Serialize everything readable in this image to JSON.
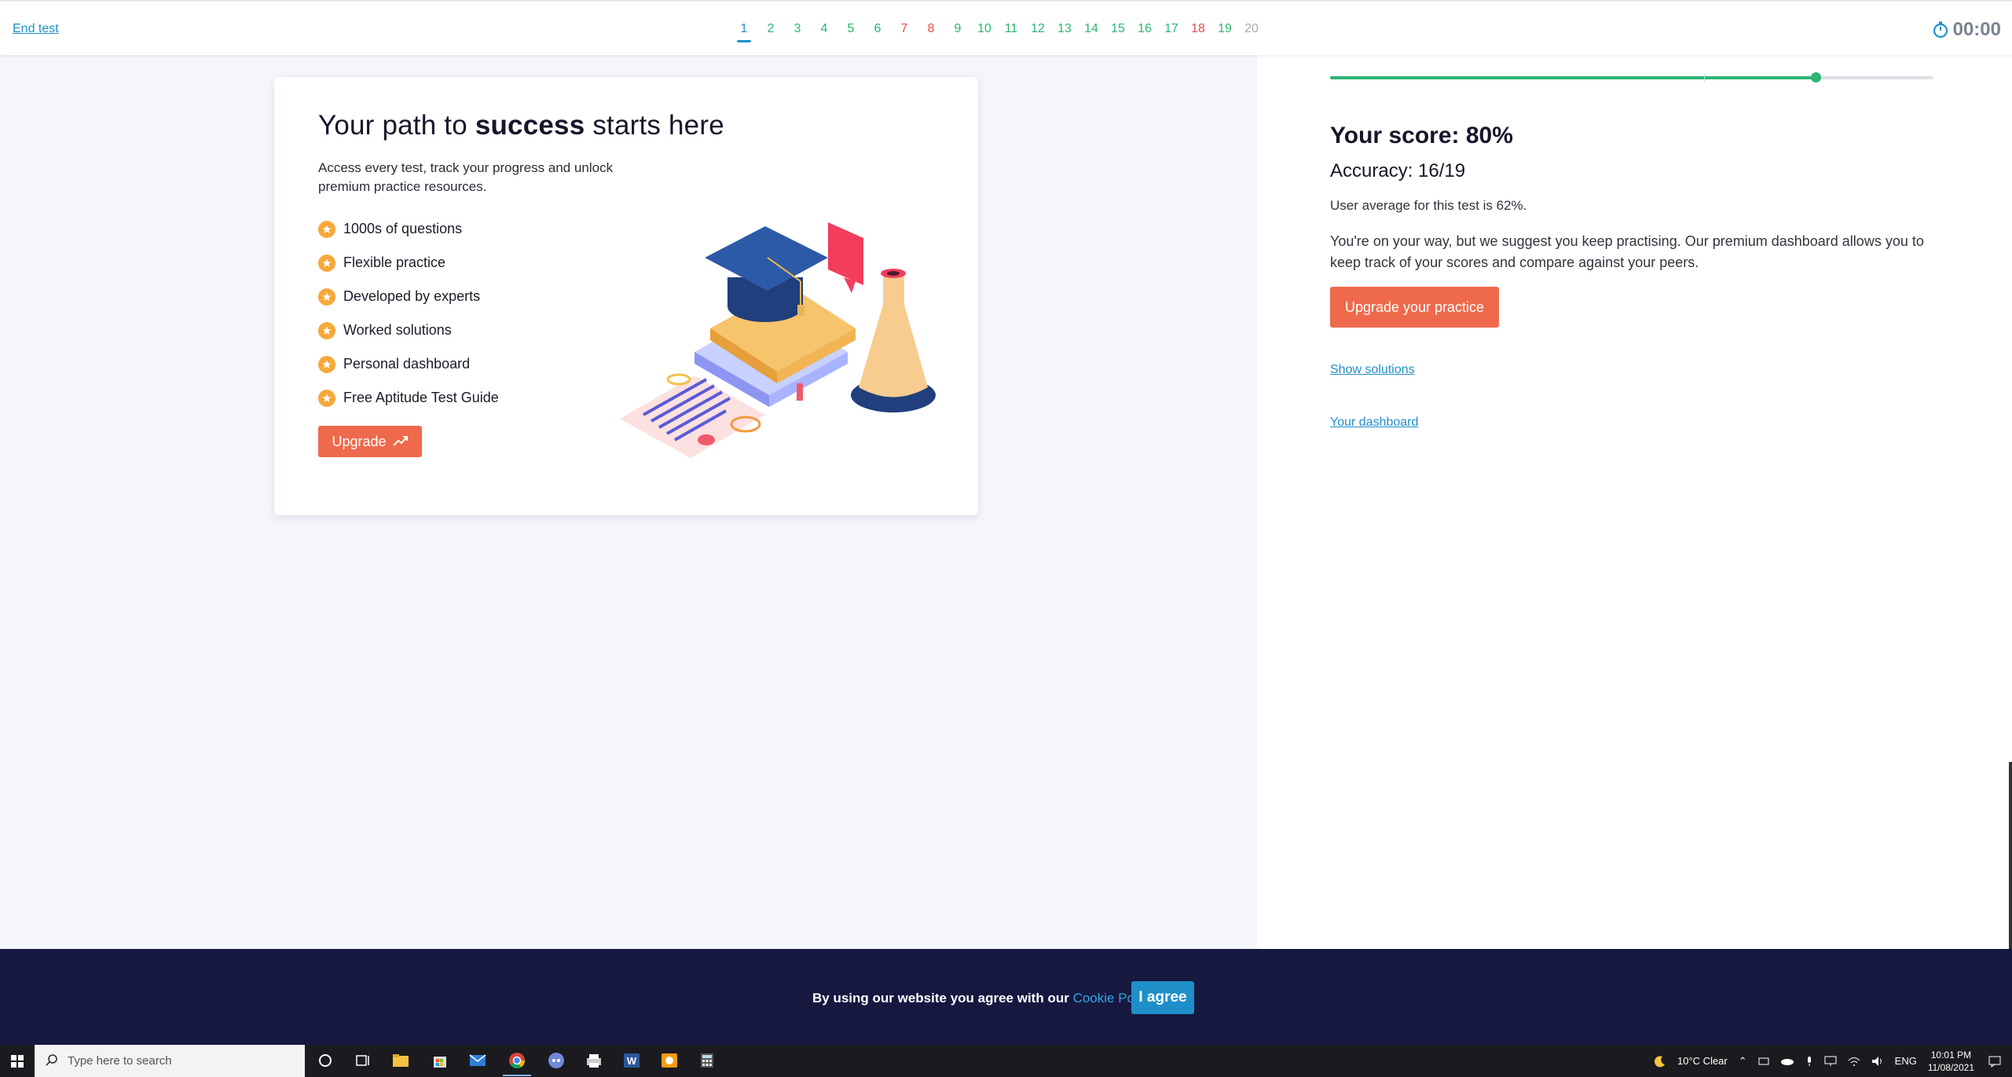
{
  "topbar": {
    "end_test": "End test",
    "timer": "00:00",
    "questions": [
      {
        "n": "1",
        "status": "active"
      },
      {
        "n": "2",
        "status": "correct"
      },
      {
        "n": "3",
        "status": "correct"
      },
      {
        "n": "4",
        "status": "correct"
      },
      {
        "n": "5",
        "status": "correct"
      },
      {
        "n": "6",
        "status": "correct"
      },
      {
        "n": "7",
        "status": "wrong"
      },
      {
        "n": "8",
        "status": "wrong"
      },
      {
        "n": "9",
        "status": "correct"
      },
      {
        "n": "10",
        "status": "correct"
      },
      {
        "n": "11",
        "status": "correct"
      },
      {
        "n": "12",
        "status": "correct"
      },
      {
        "n": "13",
        "status": "correct"
      },
      {
        "n": "14",
        "status": "correct"
      },
      {
        "n": "15",
        "status": "correct"
      },
      {
        "n": "16",
        "status": "correct"
      },
      {
        "n": "17",
        "status": "correct"
      },
      {
        "n": "18",
        "status": "wrong"
      },
      {
        "n": "19",
        "status": "correct"
      },
      {
        "n": "20",
        "status": "pending"
      }
    ],
    "colors": {
      "correct": "#2bb673",
      "wrong": "#ee4c4c",
      "pending": "#a9a9b4",
      "active": "#1f8fc9"
    }
  },
  "promo": {
    "title_pre": "Your path to ",
    "title_bold": "success",
    "title_post": " starts here",
    "description": "Access every test, track your progress and unlock premium practice resources.",
    "features": [
      "1000s of questions",
      "Flexible practice",
      "Developed by experts",
      "Worked solutions",
      "Personal dashboard",
      "Free Aptitude Test Guide"
    ],
    "upgrade_label": "Upgrade",
    "illustration": "graduation-cap-books-flask-illustration"
  },
  "results": {
    "progress_fraction": 0.805,
    "progress_marker_fraction": 0.62,
    "score": "Your score: 80%",
    "accuracy": "Accuracy: 16/19",
    "average": "User average for this test is 62%.",
    "advice": "You're on your way, but we suggest you keep practising. Our premium dashboard allows you to keep track of your scores and compare against your peers.",
    "upgrade_practice": "Upgrade your practice",
    "show_solutions": "Show solutions",
    "your_dashboard": "Your dashboard"
  },
  "cookie": {
    "text": "By using our website you agree with our ",
    "policy_link": "Cookie Policy.",
    "agree": "I agree"
  },
  "taskbar": {
    "search_placeholder": "Type here to search",
    "weather": "10°C  Clear",
    "language": "ENG",
    "time": "10:01 PM",
    "date": "11/08/2021",
    "pinned_icons": [
      "cortana-icon",
      "task-view-icon",
      "file-explorer-icon",
      "store-icon",
      "mail-icon",
      "chrome-icon",
      "discord-icon",
      "printer-app-icon",
      "word-icon",
      "orange-app-icon",
      "calculator-icon"
    ]
  },
  "accent": {
    "brand_orange": "#ef6a4c",
    "link_blue": "#1f8fc9",
    "success_green": "#2bb673",
    "banner_navy": "#161840"
  }
}
